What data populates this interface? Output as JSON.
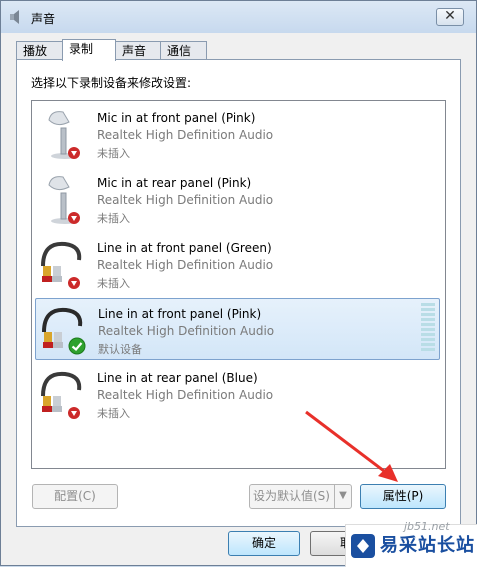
{
  "window": {
    "title": "声音",
    "close_label": "✕"
  },
  "tabs": [
    {
      "label": "播放"
    },
    {
      "label": "录制"
    },
    {
      "label": "声音"
    },
    {
      "label": "通信"
    }
  ],
  "instructions": "选择以下录制设备来修改设置:",
  "devices": [
    {
      "name": "Mic in at front panel (Pink)",
      "driver": "Realtek High Definition Audio",
      "status": "未插入",
      "icon": "microphone-icon",
      "badge": "unplugged-icon"
    },
    {
      "name": "Mic in at rear panel (Pink)",
      "driver": "Realtek High Definition Audio",
      "status": "未插入",
      "icon": "microphone-icon",
      "badge": "unplugged-icon"
    },
    {
      "name": "Line in at front panel (Green)",
      "driver": "Realtek High Definition Audio",
      "status": "未插入",
      "icon": "line-in-cable-icon",
      "badge": "unplugged-icon"
    },
    {
      "name": "Line in at front panel (Pink)",
      "driver": "Realtek High Definition Audio",
      "status": "默认设备",
      "icon": "line-in-cable-icon",
      "badge": "default-check-icon",
      "selected": true
    },
    {
      "name": "Line in at rear panel (Blue)",
      "driver": "Realtek High Definition Audio",
      "status": "未插入",
      "icon": "line-in-cable-icon",
      "badge": "unplugged-icon"
    }
  ],
  "buttons": {
    "configure": "配置(C)",
    "set_default": "设为默认值(S)",
    "properties": "属性(P)",
    "ok": "确定",
    "cancel": "取"
  },
  "watermark": {
    "brand": "易采站长站",
    "site": "jb51.net"
  },
  "colors": {
    "accent": "#3c7fb1",
    "selection": "#d3e6f8",
    "arrow": "#e8302a",
    "brand": "#1a4fa0"
  }
}
